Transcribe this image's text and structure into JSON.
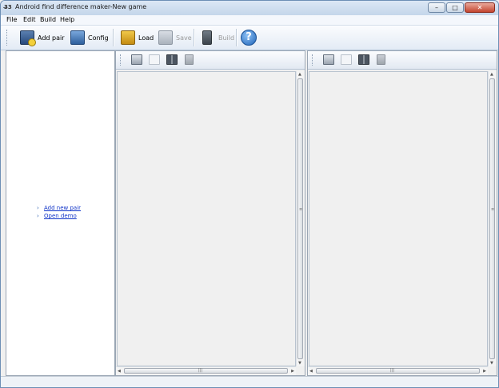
{
  "window": {
    "title": "Android find difference maker-New game",
    "app_icon": "app-icon",
    "min_glyph": "–",
    "max_glyph": "□",
    "close_glyph": "✕"
  },
  "menu": {
    "items": [
      "File",
      "Edit",
      "Build",
      "Help"
    ]
  },
  "toolbar": {
    "add_pair": "Add pair",
    "config": "Config",
    "load": "Load",
    "save": "Save",
    "build": "Build",
    "help_glyph": "?"
  },
  "left_panel": {
    "links": [
      "Add new pair",
      "Open demo"
    ]
  },
  "panes": {
    "left": {
      "icons": [
        "zoom-fit-icon",
        "zoom-reset-icon",
        "compare-icon",
        "clear-icon"
      ]
    },
    "right": {
      "icons": [
        "zoom-fit-icon",
        "zoom-reset-icon",
        "compare-icon",
        "clear-icon"
      ]
    }
  }
}
